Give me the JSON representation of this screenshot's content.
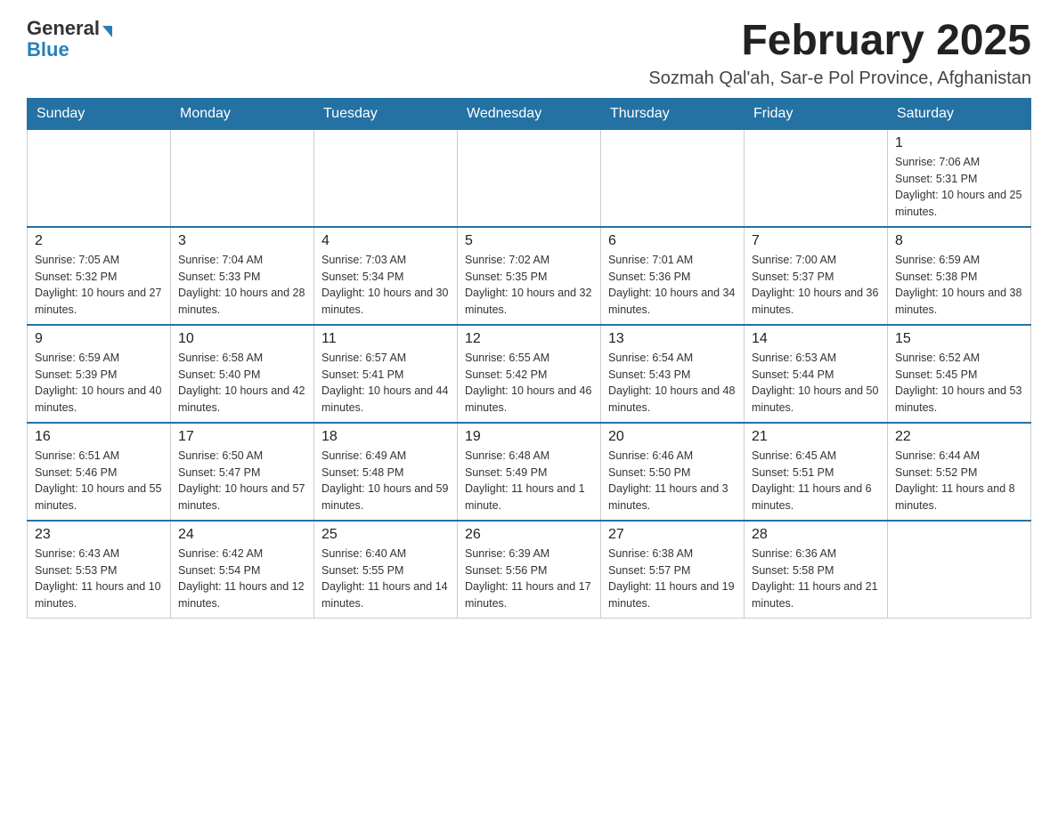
{
  "header": {
    "logo_general": "General",
    "logo_blue": "Blue",
    "month_title": "February 2025",
    "location": "Sozmah Qal'ah, Sar-e Pol Province, Afghanistan"
  },
  "weekdays": [
    "Sunday",
    "Monday",
    "Tuesday",
    "Wednesday",
    "Thursday",
    "Friday",
    "Saturday"
  ],
  "weeks": [
    [
      {
        "day": "",
        "info": ""
      },
      {
        "day": "",
        "info": ""
      },
      {
        "day": "",
        "info": ""
      },
      {
        "day": "",
        "info": ""
      },
      {
        "day": "",
        "info": ""
      },
      {
        "day": "",
        "info": ""
      },
      {
        "day": "1",
        "info": "Sunrise: 7:06 AM\nSunset: 5:31 PM\nDaylight: 10 hours and 25 minutes."
      }
    ],
    [
      {
        "day": "2",
        "info": "Sunrise: 7:05 AM\nSunset: 5:32 PM\nDaylight: 10 hours and 27 minutes."
      },
      {
        "day": "3",
        "info": "Sunrise: 7:04 AM\nSunset: 5:33 PM\nDaylight: 10 hours and 28 minutes."
      },
      {
        "day": "4",
        "info": "Sunrise: 7:03 AM\nSunset: 5:34 PM\nDaylight: 10 hours and 30 minutes."
      },
      {
        "day": "5",
        "info": "Sunrise: 7:02 AM\nSunset: 5:35 PM\nDaylight: 10 hours and 32 minutes."
      },
      {
        "day": "6",
        "info": "Sunrise: 7:01 AM\nSunset: 5:36 PM\nDaylight: 10 hours and 34 minutes."
      },
      {
        "day": "7",
        "info": "Sunrise: 7:00 AM\nSunset: 5:37 PM\nDaylight: 10 hours and 36 minutes."
      },
      {
        "day": "8",
        "info": "Sunrise: 6:59 AM\nSunset: 5:38 PM\nDaylight: 10 hours and 38 minutes."
      }
    ],
    [
      {
        "day": "9",
        "info": "Sunrise: 6:59 AM\nSunset: 5:39 PM\nDaylight: 10 hours and 40 minutes."
      },
      {
        "day": "10",
        "info": "Sunrise: 6:58 AM\nSunset: 5:40 PM\nDaylight: 10 hours and 42 minutes."
      },
      {
        "day": "11",
        "info": "Sunrise: 6:57 AM\nSunset: 5:41 PM\nDaylight: 10 hours and 44 minutes."
      },
      {
        "day": "12",
        "info": "Sunrise: 6:55 AM\nSunset: 5:42 PM\nDaylight: 10 hours and 46 minutes."
      },
      {
        "day": "13",
        "info": "Sunrise: 6:54 AM\nSunset: 5:43 PM\nDaylight: 10 hours and 48 minutes."
      },
      {
        "day": "14",
        "info": "Sunrise: 6:53 AM\nSunset: 5:44 PM\nDaylight: 10 hours and 50 minutes."
      },
      {
        "day": "15",
        "info": "Sunrise: 6:52 AM\nSunset: 5:45 PM\nDaylight: 10 hours and 53 minutes."
      }
    ],
    [
      {
        "day": "16",
        "info": "Sunrise: 6:51 AM\nSunset: 5:46 PM\nDaylight: 10 hours and 55 minutes."
      },
      {
        "day": "17",
        "info": "Sunrise: 6:50 AM\nSunset: 5:47 PM\nDaylight: 10 hours and 57 minutes."
      },
      {
        "day": "18",
        "info": "Sunrise: 6:49 AM\nSunset: 5:48 PM\nDaylight: 10 hours and 59 minutes."
      },
      {
        "day": "19",
        "info": "Sunrise: 6:48 AM\nSunset: 5:49 PM\nDaylight: 11 hours and 1 minute."
      },
      {
        "day": "20",
        "info": "Sunrise: 6:46 AM\nSunset: 5:50 PM\nDaylight: 11 hours and 3 minutes."
      },
      {
        "day": "21",
        "info": "Sunrise: 6:45 AM\nSunset: 5:51 PM\nDaylight: 11 hours and 6 minutes."
      },
      {
        "day": "22",
        "info": "Sunrise: 6:44 AM\nSunset: 5:52 PM\nDaylight: 11 hours and 8 minutes."
      }
    ],
    [
      {
        "day": "23",
        "info": "Sunrise: 6:43 AM\nSunset: 5:53 PM\nDaylight: 11 hours and 10 minutes."
      },
      {
        "day": "24",
        "info": "Sunrise: 6:42 AM\nSunset: 5:54 PM\nDaylight: 11 hours and 12 minutes."
      },
      {
        "day": "25",
        "info": "Sunrise: 6:40 AM\nSunset: 5:55 PM\nDaylight: 11 hours and 14 minutes."
      },
      {
        "day": "26",
        "info": "Sunrise: 6:39 AM\nSunset: 5:56 PM\nDaylight: 11 hours and 17 minutes."
      },
      {
        "day": "27",
        "info": "Sunrise: 6:38 AM\nSunset: 5:57 PM\nDaylight: 11 hours and 19 minutes."
      },
      {
        "day": "28",
        "info": "Sunrise: 6:36 AM\nSunset: 5:58 PM\nDaylight: 11 hours and 21 minutes."
      },
      {
        "day": "",
        "info": ""
      }
    ]
  ]
}
